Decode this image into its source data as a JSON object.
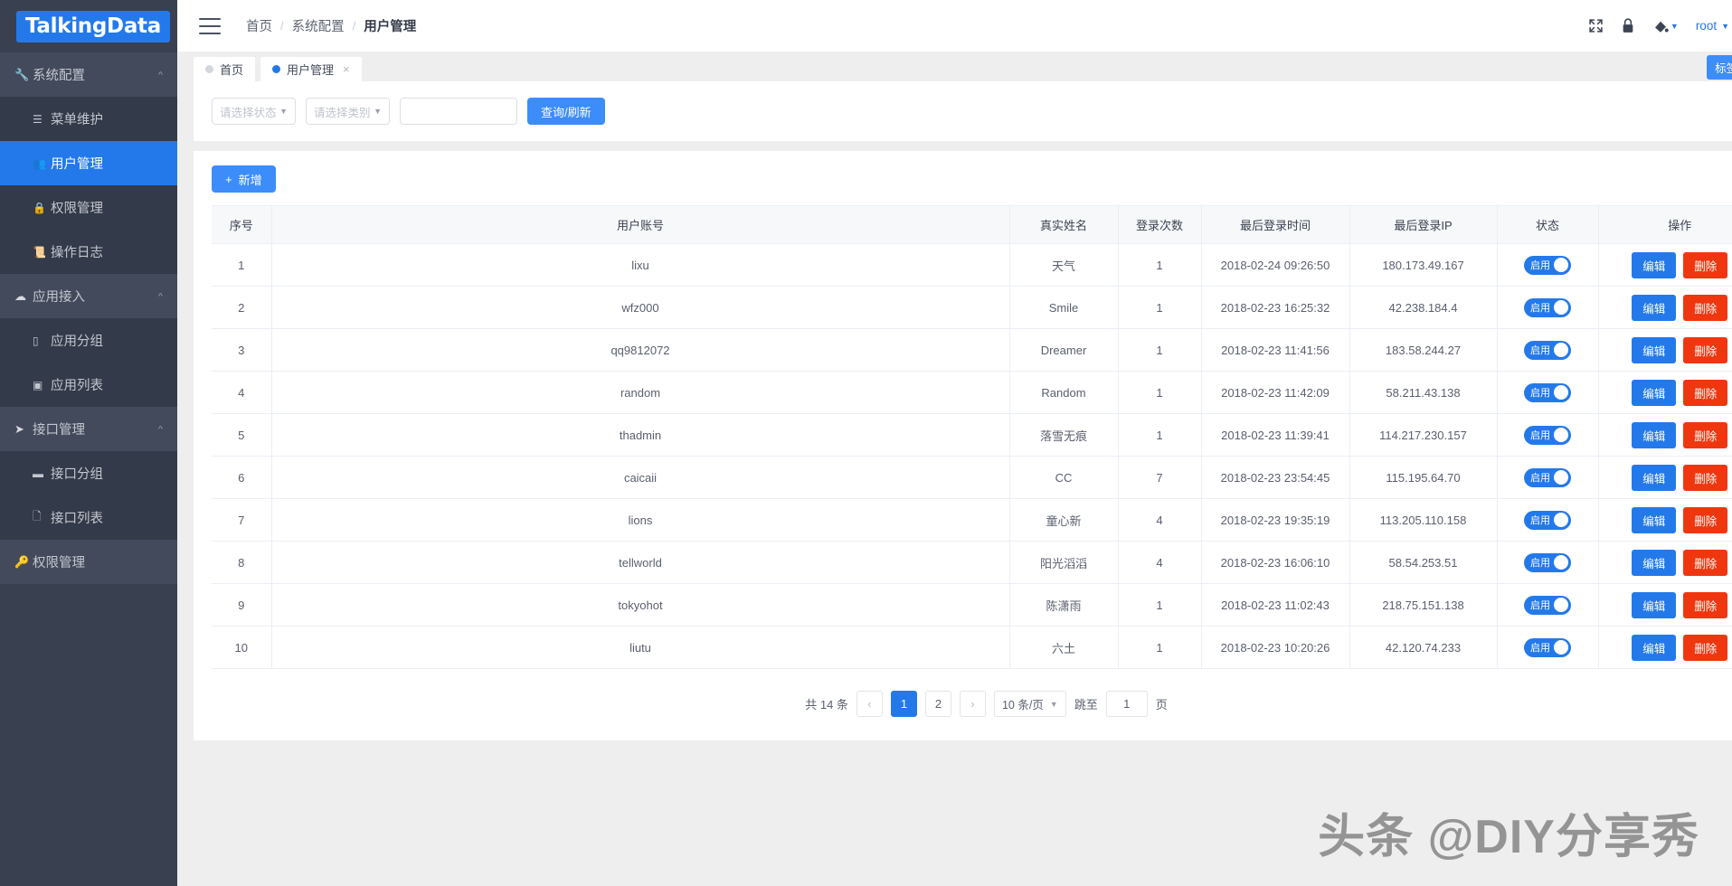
{
  "brand": {
    "logo_text": "TalkingData"
  },
  "sidebar": {
    "groups": [
      {
        "label": "系统配置",
        "icon": "wrench-icon",
        "expanded": true,
        "items": [
          {
            "label": "菜单维护",
            "icon": "menu-list-icon",
            "active": false
          },
          {
            "label": "用户管理",
            "icon": "users-icon",
            "active": true
          },
          {
            "label": "权限管理",
            "icon": "lock-icon",
            "active": false
          },
          {
            "label": "操作日志",
            "icon": "journal-icon",
            "active": false
          }
        ]
      },
      {
        "label": "应用接入",
        "icon": "cloud-icon",
        "expanded": true,
        "items": [
          {
            "label": "应用分组",
            "icon": "folder-icon",
            "active": false
          },
          {
            "label": "应用列表",
            "icon": "list-icon",
            "active": false
          }
        ]
      },
      {
        "label": "接口管理",
        "icon": "send-icon",
        "expanded": true,
        "items": [
          {
            "label": "接口分组",
            "icon": "folder-icon",
            "active": false
          },
          {
            "label": "接口列表",
            "icon": "file-icon",
            "active": false
          }
        ]
      }
    ],
    "leaf": {
      "label": "权限管理",
      "icon": "key-icon"
    }
  },
  "topbar": {
    "menu_icon": "hamburger-icon",
    "breadcrumb": [
      "首页",
      "系统配置",
      "用户管理"
    ],
    "breadcrumb_separator": "/",
    "icons": [
      "fullscreen-icon",
      "lock-icon",
      "theme-fill-icon"
    ],
    "username": "root"
  },
  "tabs": {
    "items": [
      {
        "label": "首页",
        "active": false,
        "closable": false
      },
      {
        "label": "用户管理",
        "active": true,
        "closable": true
      }
    ],
    "close_glyph": "×",
    "tag_options_label": "标签选项"
  },
  "filters": {
    "status_placeholder": "请选择状态",
    "category_placeholder": "请选择类别",
    "keyword_value": "",
    "keyword_placeholder": "",
    "query_label": "查询/刷新"
  },
  "toolbar": {
    "add_label": "新增",
    "add_icon": "plus-icon"
  },
  "table": {
    "columns": [
      "序号",
      "用户账号",
      "真实姓名",
      "登录次数",
      "最后登录时间",
      "最后登录IP",
      "状态",
      "操作"
    ],
    "rows": [
      {
        "no": "1",
        "account": "lixu",
        "realname": "天气",
        "logins": "1",
        "last_login": "2018-02-24 09:26:50",
        "ip": "180.173.49.167",
        "status": "启用"
      },
      {
        "no": "2",
        "account": "wfz000",
        "realname": "Smile",
        "logins": "1",
        "last_login": "2018-02-23 16:25:32",
        "ip": "42.238.184.4",
        "status": "启用"
      },
      {
        "no": "3",
        "account": "qq9812072",
        "realname": "Dreamer",
        "logins": "1",
        "last_login": "2018-02-23 11:41:56",
        "ip": "183.58.244.27",
        "status": "启用"
      },
      {
        "no": "4",
        "account": "random",
        "realname": "Random",
        "logins": "1",
        "last_login": "2018-02-23 11:42:09",
        "ip": "58.211.43.138",
        "status": "启用"
      },
      {
        "no": "5",
        "account": "thadmin",
        "realname": "落雪无痕",
        "logins": "1",
        "last_login": "2018-02-23 11:39:41",
        "ip": "114.217.230.157",
        "status": "启用"
      },
      {
        "no": "6",
        "account": "caicaii",
        "realname": "CC",
        "logins": "7",
        "last_login": "2018-02-23 23:54:45",
        "ip": "115.195.64.70",
        "status": "启用"
      },
      {
        "no": "7",
        "account": "lions",
        "realname": "童心新",
        "logins": "4",
        "last_login": "2018-02-23 19:35:19",
        "ip": "113.205.110.158",
        "status": "启用"
      },
      {
        "no": "8",
        "account": "tellworld",
        "realname": "阳光滔滔",
        "logins": "4",
        "last_login": "2018-02-23 16:06:10",
        "ip": "58.54.253.51",
        "status": "启用"
      },
      {
        "no": "9",
        "account": "tokyohot",
        "realname": "陈潇雨",
        "logins": "1",
        "last_login": "2018-02-23 11:02:43",
        "ip": "218.75.151.138",
        "status": "启用"
      },
      {
        "no": "10",
        "account": "liutu",
        "realname": "六土",
        "logins": "1",
        "last_login": "2018-02-23 10:20:26",
        "ip": "42.120.74.233",
        "status": "启用"
      }
    ],
    "row_actions": {
      "edit_label": "编辑",
      "delete_label": "删除"
    }
  },
  "pagination": {
    "total_text": "共 14 条",
    "prev_glyph": "‹",
    "next_glyph": "›",
    "pages": [
      "1",
      "2"
    ],
    "current_page": "1",
    "page_size_label": "10 条/页",
    "jump_label": "跳至",
    "jump_value": "1",
    "jump_unit": "页"
  },
  "watermark": {
    "text": "头条 @DIY分享秀"
  },
  "colors": {
    "brand_blue": "#2479ea",
    "button_blue": "#3c8dfa",
    "delete_red": "#f0360f",
    "sidebar_bg": "#394050",
    "sidebar_sub_bg": "#333a49",
    "page_bg": "#eeeeee"
  }
}
